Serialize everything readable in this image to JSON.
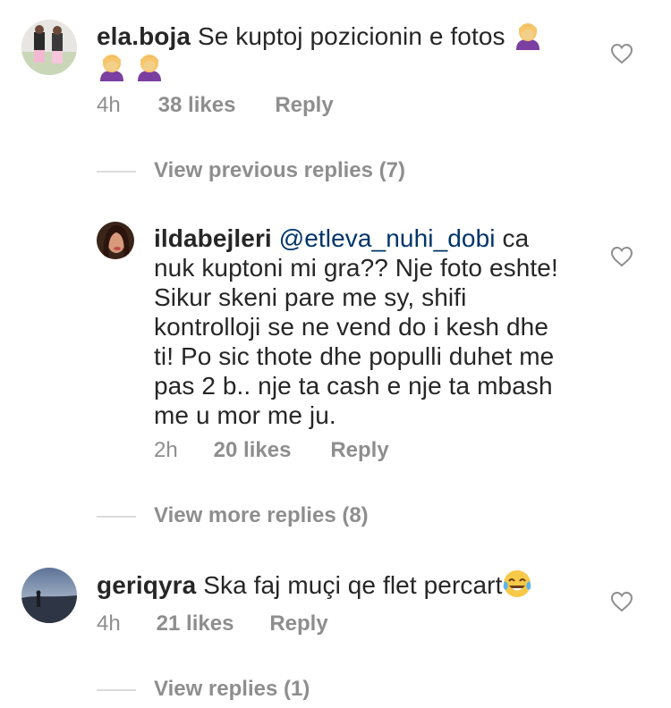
{
  "comments": [
    {
      "username": "ela.boja",
      "text": "Se kuptoj pozicionin e fotos",
      "emoji": "woman-facepalming-emoji",
      "time": "4h",
      "likes": "38 likes",
      "reply": "Reply"
    },
    {
      "view_label": "View previous replies (7)"
    },
    {
      "username": "ildabejleri",
      "mention": "@etleva_nuhi_dobi",
      "text_lines": [
        "ca",
        "nuk kuptoni mi gra?? Nje foto eshte!",
        "Sikur skeni pare me sy, shifi",
        "kontrolloji se ne vend do i kesh dhe",
        "ti! Po sic thote dhe populli duhet me",
        "pas 2 b.. nje ta cash e nje ta mbash",
        "me u mor me ju."
      ],
      "time": "2h",
      "likes": "20 likes",
      "reply": "Reply"
    },
    {
      "view_label": "View more replies (8)"
    },
    {
      "username": "geriqyra",
      "text": "Ska faj muçi qe flet percart",
      "emoji": "tears-of-joy-emoji",
      "time": "4h",
      "likes": "21 likes",
      "reply": "Reply"
    },
    {
      "view_label": "View replies (1)"
    }
  ],
  "colors": {
    "text": "#262626",
    "secondary": "#8e8e8e",
    "mention": "#003569",
    "divider": "#dbdbdb"
  }
}
